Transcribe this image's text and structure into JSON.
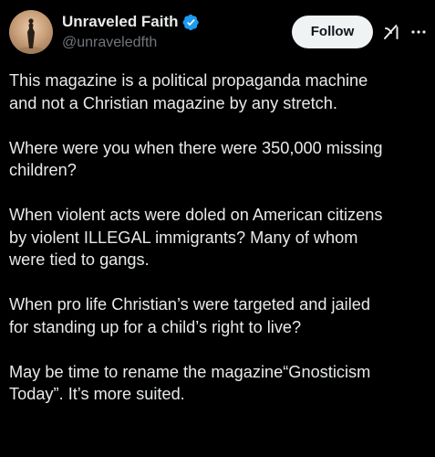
{
  "author": {
    "display_name": "Unraveled Faith",
    "handle": "@unraveledfth",
    "verified": true
  },
  "actions": {
    "follow_label": "Follow",
    "grok_icon": "grok-icon",
    "more_icon": "more-icon"
  },
  "post": {
    "paragraphs": [
      {
        "lines": [
          "This magazine is a political propaganda machine",
          "and not a Christian magazine by any stretch."
        ]
      },
      {
        "lines": [
          "Where were you when there were 350,000 missing",
          "children?"
        ]
      },
      {
        "lines": [
          "When violent acts were doled on American citizens",
          "by violent ILLEGAL immigrants? Many of whom",
          "were tied to gangs."
        ]
      },
      {
        "lines": [
          "When pro life Christian’s were targeted and jailed",
          "for standing up for a child’s right to live?"
        ]
      },
      {
        "lines": [
          "May be time to rename the  magazine“Gnosticism",
          "Today”. It’s more suited."
        ]
      }
    ]
  },
  "colors": {
    "background": "#000000",
    "text_primary": "#e7e9ea",
    "text_secondary": "#71767b",
    "verified_badge": "#1d9bf0",
    "follow_button_bg": "#eff3f4",
    "follow_button_text": "#0f1419"
  }
}
